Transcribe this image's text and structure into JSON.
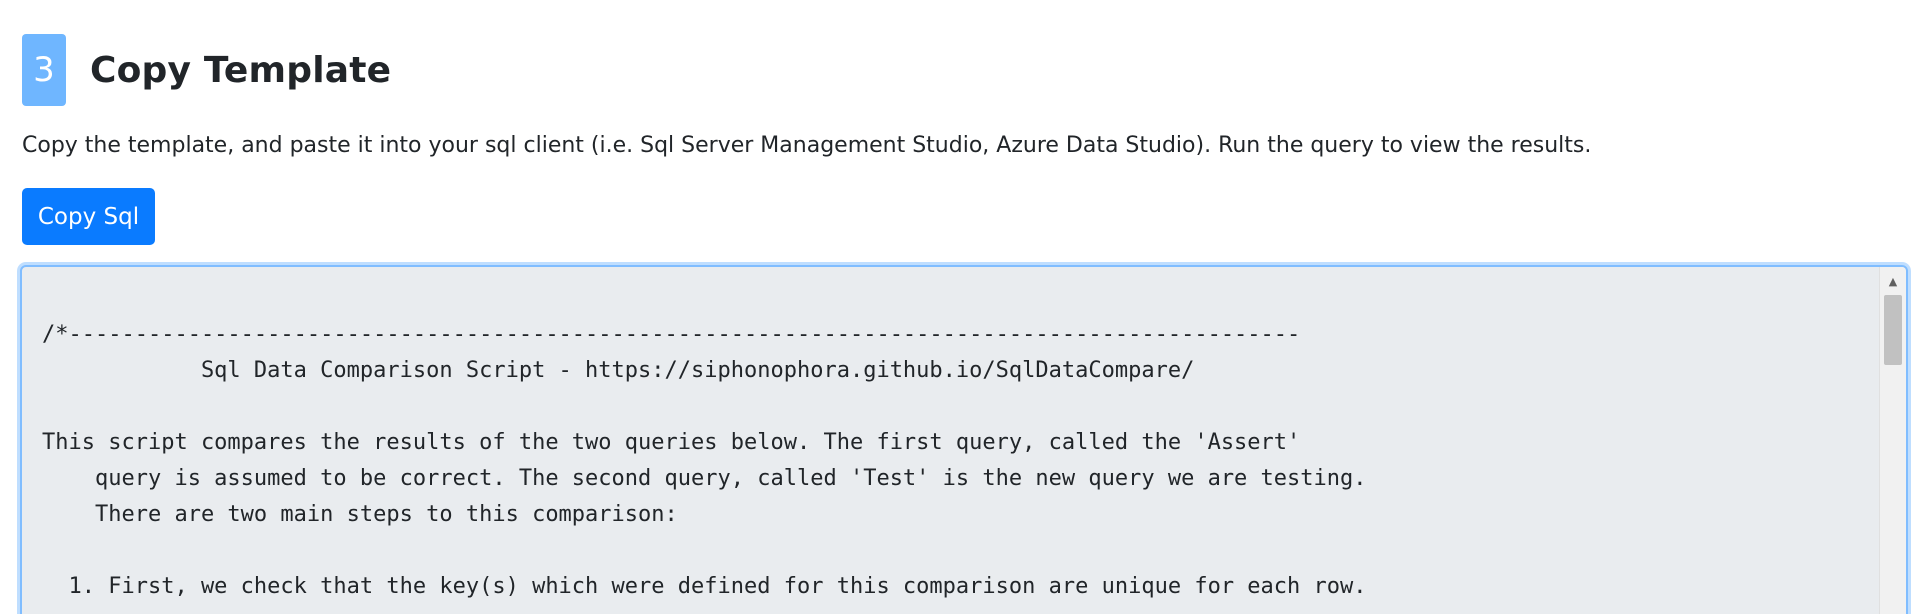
{
  "step": {
    "number": "3",
    "title": "Copy Template"
  },
  "description": "Copy the template, and paste it into your sql client (i.e. Sql Server Management Studio, Azure Data Studio). Run the query to view the results.",
  "copy_button": {
    "label": "Copy Sql"
  },
  "sql_textarea": {
    "lines": [
      "/*---------------------------------------------------------------------------------------------",
      "            Sql Data Comparison Script - https://siphonophora.github.io/SqlDataCompare/",
      "",
      "This script compares the results of the two queries below. The first query, called the 'Assert'",
      "    query is assumed to be correct. The second query, called 'Test' is the new query we are testing.",
      "    There are two main steps to this comparison:",
      "",
      "  1. First, we check that the key(s) which were defined for this comparison are unique for each row."
    ]
  },
  "icons": {
    "scroll_up": "triangle-up-icon"
  },
  "colors": {
    "badge": "#6fb6ff",
    "button": "#0a7bff",
    "textarea_bg": "#e9ecef",
    "focus_border": "#80bdff"
  }
}
